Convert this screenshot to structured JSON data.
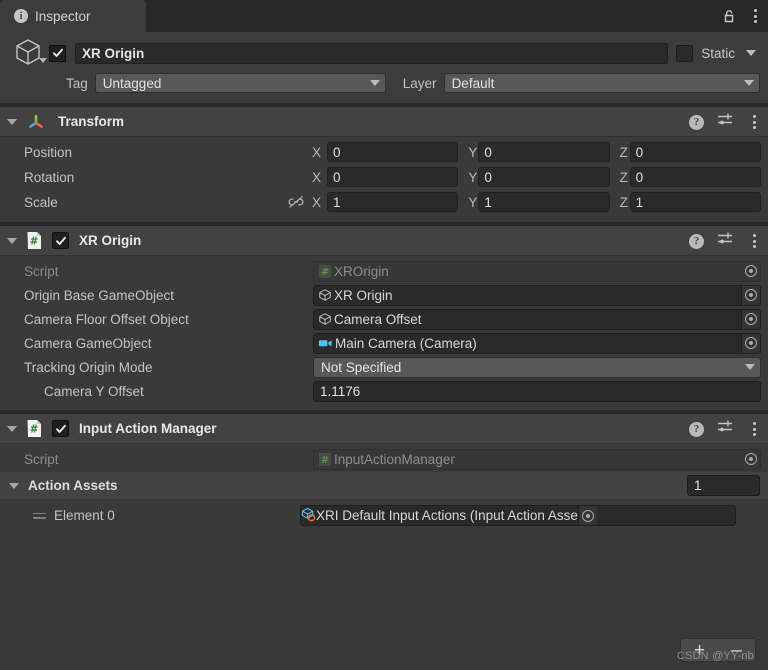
{
  "window": {
    "tab_label": "Inspector",
    "tab_icon": "info-icon",
    "lock_icon": "lock-open-icon",
    "menu_icon": "kebab-menu-icon"
  },
  "gameobject": {
    "icon": "cube-icon",
    "enabled": true,
    "name": "XR Origin",
    "static_label": "Static",
    "static_checked": false,
    "tag_label": "Tag",
    "tag_value": "Untagged",
    "layer_label": "Layer",
    "layer_value": "Default"
  },
  "components": [
    {
      "id": "transform",
      "icon": "transform-axis-icon",
      "title": "Transform",
      "has_checkbox": false,
      "help_icon": "help-icon",
      "preset_icon": "preset-settings-icon",
      "menu_icon": "kebab-menu-icon",
      "vectors": [
        {
          "label": "Position",
          "axes": [
            "X",
            "Y",
            "Z"
          ],
          "values": [
            "0",
            "0",
            "0"
          ],
          "link_icon": null
        },
        {
          "label": "Rotation",
          "axes": [
            "X",
            "Y",
            "Z"
          ],
          "values": [
            "0",
            "0",
            "0"
          ],
          "link_icon": null
        },
        {
          "label": "Scale",
          "axes": [
            "X",
            "Y",
            "Z"
          ],
          "values": [
            "1",
            "1",
            "1"
          ],
          "link_icon": "constrain-proportions-off-icon"
        }
      ]
    },
    {
      "id": "xr-origin",
      "icon": "csharp-script-icon",
      "title": "XR Origin",
      "has_checkbox": true,
      "enabled": true,
      "fields": [
        {
          "kind": "object",
          "label": "Script",
          "value": "XROrigin",
          "value_icon": "csharp-script-icon",
          "readonly": true
        },
        {
          "kind": "object",
          "label": "Origin Base GameObject",
          "value": "XR Origin",
          "value_icon": "cube-icon",
          "readonly": false
        },
        {
          "kind": "object",
          "label": "Camera Floor Offset Object",
          "value": "Camera Offset",
          "value_icon": "cube-icon",
          "readonly": false
        },
        {
          "kind": "object",
          "label": "Camera GameObject",
          "value": "Main Camera (Camera)",
          "value_icon": "camera-icon",
          "readonly": false
        },
        {
          "kind": "enum",
          "label": "Tracking Origin Mode",
          "value": "Not Specified"
        },
        {
          "kind": "number",
          "label": "Camera Y Offset",
          "value": "1.1176",
          "indent": 2
        }
      ]
    },
    {
      "id": "input-action-manager",
      "icon": "csharp-script-icon",
      "title": "Input Action Manager",
      "has_checkbox": true,
      "enabled": true,
      "fields": [
        {
          "kind": "object",
          "label": "Script",
          "value": "InputActionManager",
          "value_icon": "csharp-script-icon",
          "readonly": true
        }
      ],
      "array": {
        "title": "Action Assets",
        "size": "1",
        "elements": [
          {
            "label": "Element 0",
            "value": "XRI Default Input Actions (Input Action Asse",
            "value_icon": "input-action-asset-icon"
          }
        ],
        "add_label": "+",
        "remove_label": "–"
      }
    }
  ],
  "watermark": "CSDN @YY-nb",
  "colors": {
    "window_bg": "#383838",
    "toolbar_bg": "#282828",
    "tab_bg": "#3C3C3C",
    "component_header_bg": "#424242",
    "component_body_bg": "#3A3A3A",
    "field_bg": "#2A2A2A",
    "popup_bg": "#585858",
    "text": "#C3C3C3",
    "text_bright": "#E8E8E8",
    "text_dim": "#8C8C8C",
    "script_green": "#4E9A3E",
    "camera_cyan": "#4FC3F7"
  }
}
